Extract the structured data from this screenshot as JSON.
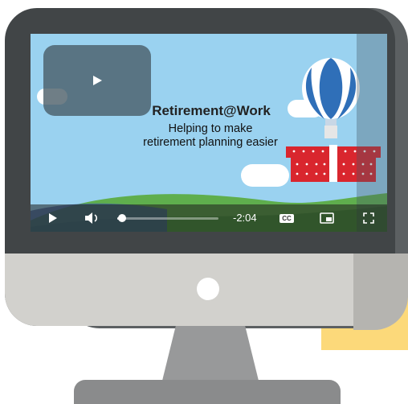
{
  "video": {
    "title": "Retirement@Work",
    "subtitle_lines": [
      "Helping to make",
      "retirement planning easier"
    ],
    "time_remaining": "-2:04",
    "progress_fraction": 0.02,
    "controls": {
      "play": "play-icon",
      "volume": "volume-icon",
      "captions": "CC",
      "pip": "picture-in-picture-icon",
      "fullscreen": "fullscreen-icon"
    }
  },
  "colors": {
    "sky": "#9ad2f0",
    "monitor_frame": "#414547",
    "monitor_chin": "#d2d1cd",
    "accent_yellow": "#fcd97a",
    "gift_red": "#d9262e"
  }
}
